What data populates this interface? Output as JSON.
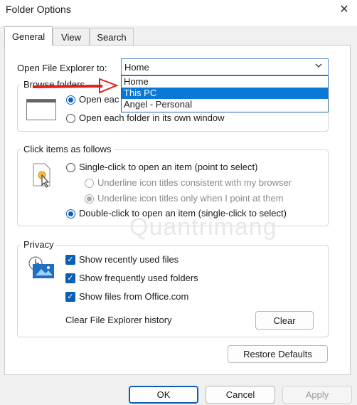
{
  "window": {
    "title": "Folder Options",
    "close_glyph": "✕"
  },
  "tabs": [
    {
      "label": "General",
      "active": true
    },
    {
      "label": "View",
      "active": false
    },
    {
      "label": "Search",
      "active": false
    }
  ],
  "open_explorer": {
    "label": "Open File Explorer to:",
    "selected": "Home",
    "options": [
      "Home",
      "This PC",
      "Angel - Personal"
    ],
    "highlighted": "This PC"
  },
  "browse_folders": {
    "legend": "Browse folders",
    "option_same": "Open each folder in the same window",
    "option_same_visible": "Open eac",
    "option_own": "Open each folder in its own window"
  },
  "click_items": {
    "legend": "Click items as follows",
    "single_click": "Single-click to open an item (point to select)",
    "underline_consistent": "Underline icon titles consistent with my browser",
    "underline_point": "Underline icon titles only when I point at them",
    "double_click": "Double-click to open an item (single-click to select)"
  },
  "privacy": {
    "legend": "Privacy",
    "show_recent": "Show recently used files",
    "show_frequent": "Show frequently used folders",
    "show_office": "Show files from Office.com",
    "clear_history_label": "Clear File Explorer history",
    "clear_button": "Clear"
  },
  "restore_defaults": "Restore Defaults",
  "footer": {
    "ok": "OK",
    "cancel": "Cancel",
    "apply": "Apply"
  },
  "watermark": "Quantrimang",
  "colors": {
    "accent": "#0a5fb4",
    "highlight": "#0a78d7",
    "arrow": "#e0201b"
  }
}
